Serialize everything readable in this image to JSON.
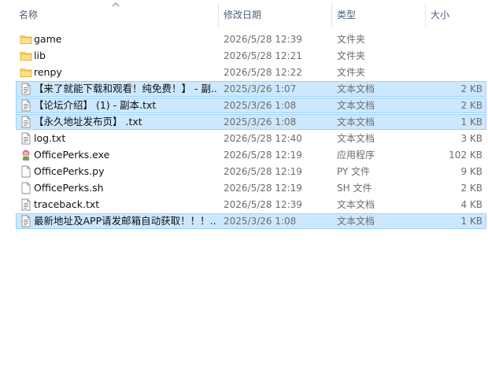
{
  "columns": {
    "name": "名称",
    "date": "修改日期",
    "type": "类型",
    "size": "大小"
  },
  "files": [
    {
      "name": "game",
      "date": "2026/5/28 12:39",
      "type": "文件夹",
      "size": "",
      "icon": "folder-icon",
      "selected": false
    },
    {
      "name": "lib",
      "date": "2026/5/28 12:21",
      "type": "文件夹",
      "size": "",
      "icon": "folder-icon",
      "selected": false
    },
    {
      "name": "renpy",
      "date": "2026/5/28 12:22",
      "type": "文件夹",
      "size": "",
      "icon": "folder-icon",
      "selected": false
    },
    {
      "name": "【来了就能下载和观看！纯免费！】 - 副...",
      "date": "2025/3/26 1:07",
      "type": "文本文档",
      "size": "2 KB",
      "icon": "text-file-icon",
      "selected": true
    },
    {
      "name": "【论坛介绍】 (1) - 副本.txt",
      "date": "2025/3/26 1:08",
      "type": "文本文档",
      "size": "2 KB",
      "icon": "text-file-icon",
      "selected": true
    },
    {
      "name": "【永久地址发布页】 .txt",
      "date": "2025/3/26 1:08",
      "type": "文本文档",
      "size": "1 KB",
      "icon": "text-file-icon",
      "selected": true
    },
    {
      "name": "log.txt",
      "date": "2026/5/28 12:40",
      "type": "文本文档",
      "size": "3 KB",
      "icon": "text-file-icon",
      "selected": false
    },
    {
      "name": "OfficePerks.exe",
      "date": "2026/5/28 12:19",
      "type": "应用程序",
      "size": "102 KB",
      "icon": "exe-icon",
      "selected": false
    },
    {
      "name": "OfficePerks.py",
      "date": "2026/5/28 12:19",
      "type": "PY 文件",
      "size": "9 KB",
      "icon": "blank-file-icon",
      "selected": false
    },
    {
      "name": "OfficePerks.sh",
      "date": "2026/5/28 12:19",
      "type": "SH 文件",
      "size": "2 KB",
      "icon": "blank-file-icon",
      "selected": false
    },
    {
      "name": "traceback.txt",
      "date": "2026/5/28 12:39",
      "type": "文本文档",
      "size": "4 KB",
      "icon": "text-file-icon",
      "selected": false
    },
    {
      "name": "最新地址及APP请发邮箱自动获取！！！...",
      "date": "2025/3/26 1:08",
      "type": "文本文档",
      "size": "1 KB",
      "icon": "text-file-icon",
      "selected": true
    }
  ]
}
